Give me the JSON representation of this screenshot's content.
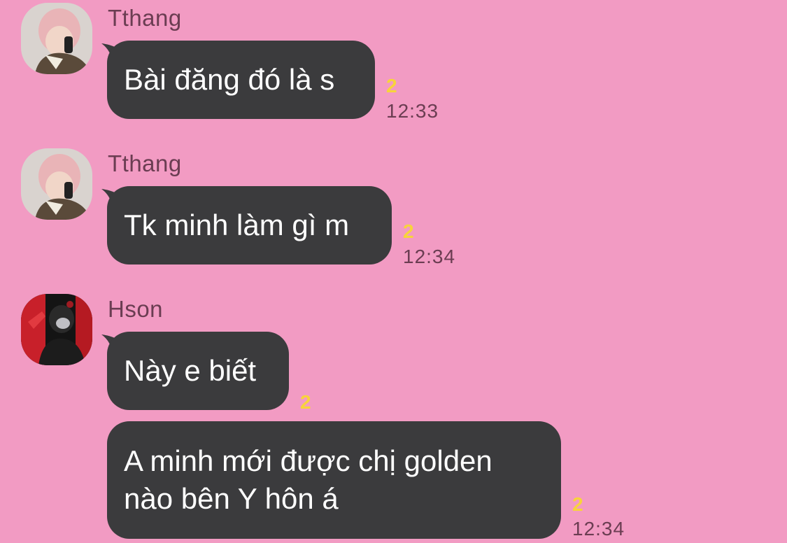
{
  "colors": {
    "background": "#f29bc3",
    "bubble": "#3b3b3d",
    "bubble_text": "#ffffff",
    "sender_name": "#6b3d52",
    "read_count": "#f8d43a"
  },
  "messages": [
    {
      "sender": "Tthang",
      "avatar": "tthang-avatar",
      "text": "Bài đăng đó là s",
      "read_count": "2",
      "time": "12:33"
    },
    {
      "sender": "Tthang",
      "avatar": "tthang-avatar",
      "text": "Tk minh làm gì m",
      "read_count": "2",
      "time": "12:34"
    },
    {
      "sender": "Hson",
      "avatar": "hson-avatar",
      "text": "Này e biết",
      "read_count": "2",
      "time": ""
    },
    {
      "sender": "",
      "avatar": "",
      "text_line1": "A minh mới được chị golden",
      "text_line2": "nào bên Y hôn á",
      "read_count": "2",
      "time": "12:34"
    }
  ]
}
